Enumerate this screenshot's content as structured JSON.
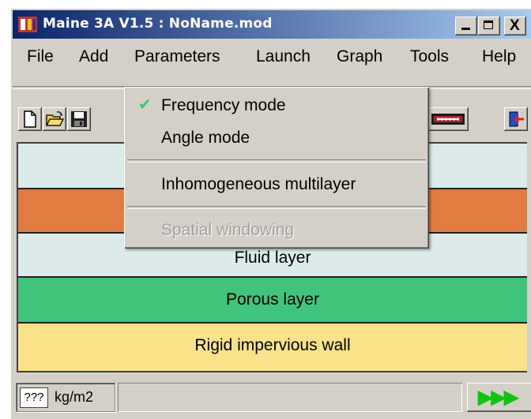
{
  "window": {
    "title": "Maine 3A V1.5 : NoName.mod",
    "controls": {
      "minimize": "_",
      "maximize": "□",
      "close": "X"
    }
  },
  "menubar": {
    "items": [
      "File",
      "Add",
      "Parameters",
      "Launch",
      "Graph",
      "Tools",
      "Help"
    ]
  },
  "toolbar": {
    "buttons": [
      "new-file-icon",
      "open-folder-icon",
      "save-disk-icon",
      "layer-stack-icon",
      "exit-door-icon"
    ]
  },
  "parameters_menu": {
    "items": [
      {
        "label": "Frequency mode",
        "checked": true,
        "enabled": true
      },
      {
        "label": "Angle mode",
        "checked": false,
        "enabled": true
      },
      {
        "label": "Inhomogeneous multilayer",
        "checked": false,
        "enabled": true
      },
      {
        "label": "Spatial windowing",
        "checked": false,
        "enabled": false
      }
    ]
  },
  "layers": [
    {
      "label": "",
      "color": "#dceaea"
    },
    {
      "label": "",
      "color": "#e07c42"
    },
    {
      "label": "Fluid layer",
      "color": "#dceaea"
    },
    {
      "label": "Porous layer",
      "color": "#40c47c"
    },
    {
      "label": "Rigid impervious wall",
      "color": "#fae28a"
    }
  ],
  "statusbar": {
    "value": "???",
    "unit": "kg/m2",
    "message": "",
    "run_label": "▶▶▶"
  },
  "colors": {
    "titlebar_start": "#0a246a",
    "titlebar_end": "#a6caf0",
    "face": "#d4d0c8",
    "check": "#3cc86a",
    "run_arrows": "#11c311"
  }
}
